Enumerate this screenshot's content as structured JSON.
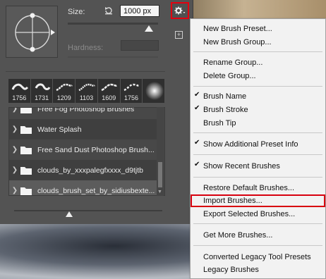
{
  "brush_panel": {
    "size_label": "Size:",
    "size_value": "1000 px",
    "hardness_label": "Hardness:",
    "presets": [
      {
        "size": "1756"
      },
      {
        "size": "1731"
      },
      {
        "size": "1209"
      },
      {
        "size": "1103"
      },
      {
        "size": "1609"
      },
      {
        "size": "1756"
      },
      {
        "size": ""
      }
    ],
    "groups": [
      {
        "label": "Free Fog Photoshop Brushes"
      },
      {
        "label": "Water Splash"
      },
      {
        "label": "Free Sand Dust Photoshop Brush..."
      },
      {
        "label": "clouds_by_xxxpalegfxxxx_d9tjtb"
      },
      {
        "label": "clouds_brush_set_by_sidiusbexte..."
      }
    ]
  },
  "flyout_menu": {
    "items": [
      {
        "label": "New Brush Preset...",
        "checked": false
      },
      {
        "label": "New Brush Group...",
        "checked": false
      },
      {
        "label": "Rename Group...",
        "checked": false
      },
      {
        "label": "Delete Group...",
        "checked": false
      },
      {
        "label": "Brush Name",
        "checked": true
      },
      {
        "label": "Brush Stroke",
        "checked": true
      },
      {
        "label": "Brush Tip",
        "checked": false
      },
      {
        "label": "Show Additional Preset Info",
        "checked": true
      },
      {
        "label": "Show Recent Brushes",
        "checked": true
      },
      {
        "label": "Restore Default Brushes...",
        "checked": false
      },
      {
        "label": "Import Brushes...",
        "checked": false
      },
      {
        "label": "Export Selected Brushes...",
        "checked": false
      },
      {
        "label": "Get More Brushes...",
        "checked": false
      },
      {
        "label": "Converted Legacy Tool Presets",
        "checked": false
      },
      {
        "label": "Legacy Brushes",
        "checked": false
      }
    ],
    "check_glyph": "✔"
  },
  "icons": {
    "gear": "gear-icon",
    "reset": "reset-size-icon",
    "folder": "folder-icon",
    "chevron": "chevron-right-icon",
    "new_panel": "new-panel-icon"
  },
  "colors": {
    "highlight_border": "#d8000f",
    "panel_bg": "#535353",
    "menu_bg": "#f2f2f2"
  }
}
